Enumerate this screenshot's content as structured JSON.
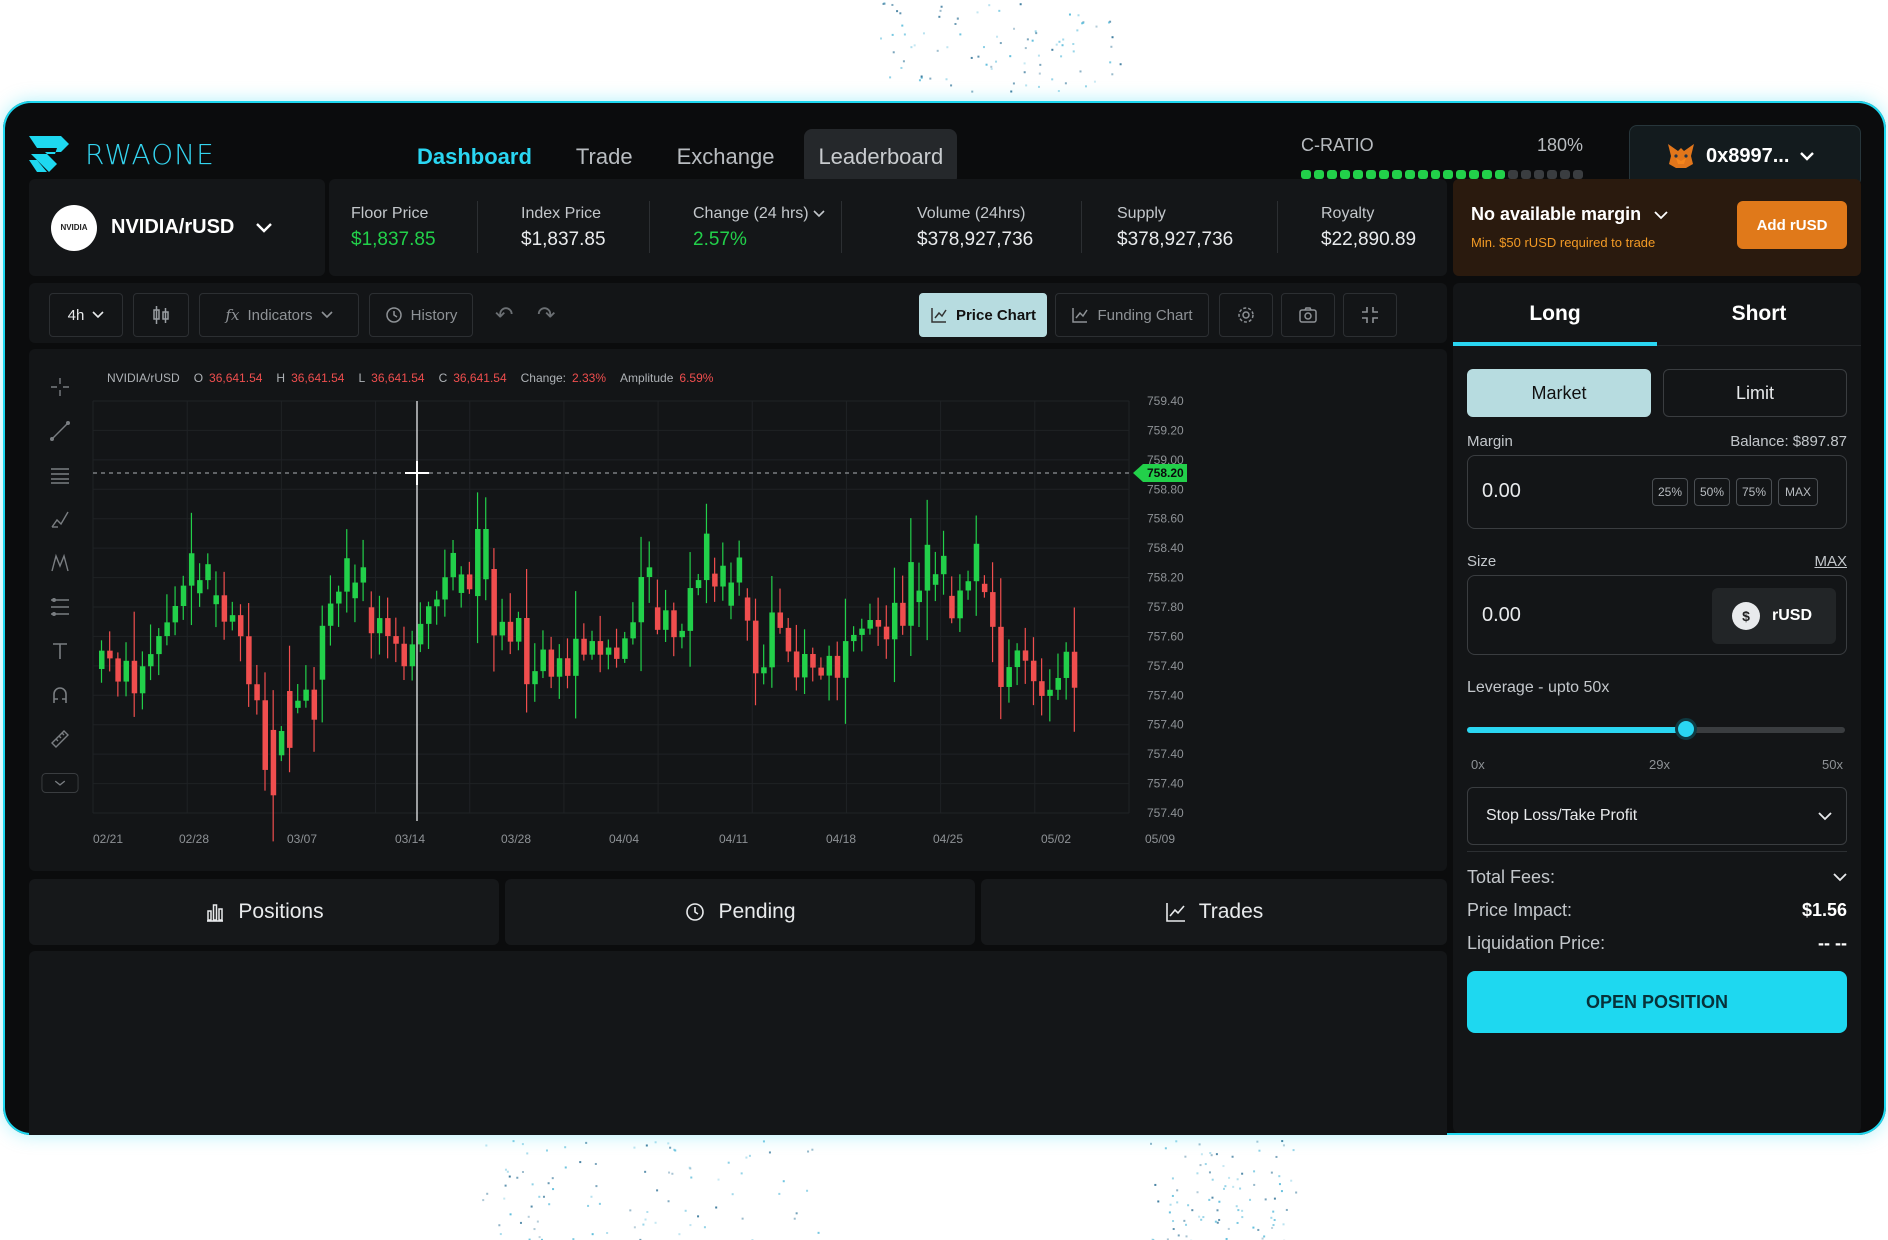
{
  "brand": {
    "name": "RWAONE",
    "accent": "#2ad6f2"
  },
  "nav": [
    {
      "label": "Dashboard"
    },
    {
      "label": "Trade"
    },
    {
      "label": "Exchange"
    },
    {
      "label": "Leaderboard"
    }
  ],
  "cratio": {
    "label": "C-RATIO",
    "value": "180%",
    "level": 0.72
  },
  "wallet": {
    "address": "0x8997..."
  },
  "pair": {
    "name": "NVIDIA/rUSD",
    "logo_text": "NVIDIA"
  },
  "stats": [
    {
      "label": "Floor Price",
      "value": "$1,837.85",
      "color": "green"
    },
    {
      "label": "Index Price",
      "value": "$1,837.85",
      "color": "white"
    },
    {
      "label": "Change (24 hrs)",
      "value": "2.57%",
      "color": "green"
    },
    {
      "label": "Volume (24hrs)",
      "value": "$378,927,736",
      "color": "white"
    },
    {
      "label": "Supply",
      "value": "$378,927,736",
      "color": "white"
    },
    {
      "label": "Royalty",
      "value": "$22,890.89",
      "color": "white"
    }
  ],
  "margin_notice": {
    "title": "No available margin",
    "subtitle": "Min. $50 rUSD required to trade",
    "button": "Add rUSD"
  },
  "toolbar": {
    "interval": "4h",
    "indicators": "Indicators",
    "history": "History",
    "price_chart": "Price Chart",
    "funding_chart": "Funding Chart"
  },
  "ohlc": {
    "pair": "NVIDIA/rUSD",
    "o_label": "O",
    "o": "36,641.54",
    "h_label": "H",
    "h": "36,641.54",
    "l_label": "L",
    "l": "36,641.54",
    "c_label": "C",
    "c": "36,641.54",
    "change_label": "Change:",
    "change": "2.33%",
    "amplitude_label": "Amplitude",
    "amplitude": "6.59%"
  },
  "chart_data": {
    "type": "candlestick",
    "x_ticks": [
      "02/21",
      "02/28",
      "03/07",
      "03/14",
      "03/28",
      "04/04",
      "04/11",
      "04/18",
      "04/25",
      "05/02",
      "05/09"
    ],
    "y_ticks": [
      "759.40",
      "759.20",
      "759.00",
      "758.80",
      "758.60",
      "758.40",
      "758.20",
      "757.80",
      "757.60",
      "757.40",
      "757.40",
      "757.40",
      "757.40",
      "757.40",
      "757.40"
    ],
    "current_price": "758.20",
    "up_color": "#22d04a",
    "down_color": "#ef4e4e",
    "grid": true
  },
  "bottom_tabs": [
    {
      "label": "Positions",
      "icon": "bar-chart-icon"
    },
    {
      "label": "Pending",
      "icon": "history-icon"
    },
    {
      "label": "Trades",
      "icon": "line-chart-icon"
    }
  ],
  "trade": {
    "long": "Long",
    "short": "Short",
    "market": "Market",
    "limit": "Limit",
    "margin_label": "Margin",
    "balance": "Balance: $897.87",
    "margin_value": "0.00",
    "pcts": [
      "25%",
      "50%",
      "75%",
      "MAX"
    ],
    "size_label": "Size",
    "size_max": "MAX",
    "size_value": "0.00",
    "currency": "rUSD",
    "leverage_label": "Leverage - upto 50x",
    "leverage_value": 29,
    "leverage_min": "0x",
    "leverage_current": "29x",
    "leverage_max": "50x",
    "sltp": "Stop Loss/Take Profit",
    "total_fees": "Total Fees:",
    "price_impact_label": "Price Impact:",
    "price_impact": "$1.56",
    "liq_label": "Liquidation Price:",
    "liq_value": "-- --",
    "open_button": "OPEN POSITION"
  }
}
